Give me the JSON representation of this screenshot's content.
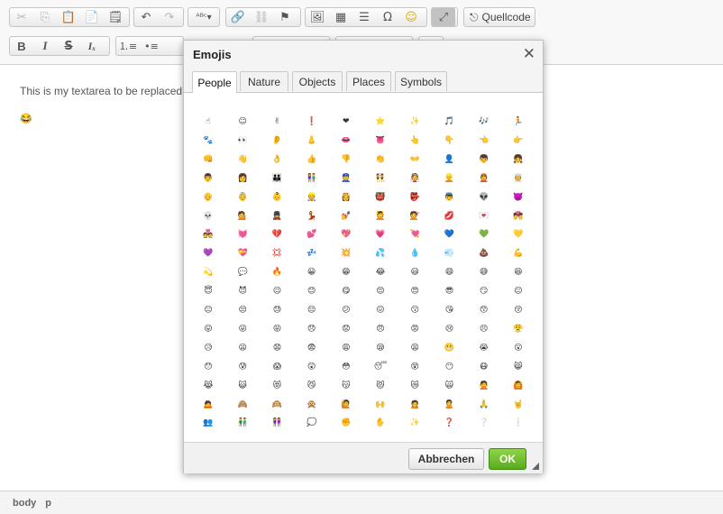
{
  "toolbar": {
    "source_label": "Quellcode"
  },
  "editor": {
    "text": "This is my textarea to be replaced",
    "emoji": "😂"
  },
  "statusbar": {
    "path": [
      "body",
      "p"
    ]
  },
  "dialog": {
    "title": "Emojis",
    "close_glyph": "✕",
    "tabs": [
      "People",
      "Nature",
      "Objects",
      "Places",
      "Symbols"
    ],
    "active_tab": "People",
    "cancel_label": "Abbrechen",
    "ok_label": "OK",
    "emoji_rows": [
      [
        "☝",
        "☺",
        "✌",
        "❗",
        "❤",
        "⭐",
        "✨",
        "🎵",
        "🎶",
        "🏃"
      ],
      [
        "🐾",
        "👀",
        "👂",
        "👃",
        "👄",
        "👅",
        "👆",
        "👇",
        "👈",
        "👉"
      ],
      [
        "👊",
        "👋",
        "👌",
        "👍",
        "👎",
        "👏",
        "👐",
        "👤",
        "👦",
        "👧"
      ],
      [
        "👨",
        "👩",
        "👪",
        "👫",
        "👮",
        "👯",
        "👰",
        "👱",
        "👲",
        "👳"
      ],
      [
        "👴",
        "👵",
        "👶",
        "👷",
        "👸",
        "👹",
        "👺",
        "👼",
        "👽",
        "👿"
      ],
      [
        "💀",
        "💁",
        "💂",
        "💃",
        "💅",
        "💆",
        "💇",
        "💋",
        "💌",
        "💏"
      ],
      [
        "💑",
        "💓",
        "💔",
        "💕",
        "💖",
        "💗",
        "💘",
        "💙",
        "💚",
        "💛"
      ],
      [
        "💜",
        "💝",
        "💢",
        "💤",
        "💥",
        "💦",
        "💧",
        "💨",
        "💩",
        "💪"
      ],
      [
        "💫",
        "💬",
        "🔥",
        "😀",
        "😁",
        "😂",
        "😃",
        "😄",
        "😅",
        "😆"
      ],
      [
        "😇",
        "😈",
        "😉",
        "😊",
        "😋",
        "😌",
        "😍",
        "😎",
        "😏",
        "😐"
      ],
      [
        "😑",
        "😒",
        "😓",
        "😔",
        "😕",
        "😖",
        "😗",
        "😘",
        "😙",
        "😚"
      ],
      [
        "😛",
        "😜",
        "😝",
        "😞",
        "😟",
        "😠",
        "😡",
        "😢",
        "😣",
        "😤"
      ],
      [
        "😥",
        "😦",
        "😧",
        "😨",
        "😩",
        "😪",
        "😫",
        "😬",
        "😭",
        "😮"
      ],
      [
        "😯",
        "😰",
        "😱",
        "😲",
        "😳",
        "😴",
        "😵",
        "😶",
        "😷",
        "😸"
      ],
      [
        "😹",
        "😺",
        "😻",
        "😼",
        "😽",
        "😾",
        "😿",
        "🙀",
        "🙅",
        "🙆"
      ],
      [
        "🙇",
        "🙈",
        "🙉",
        "🙊",
        "🙋",
        "🙌",
        "🙍",
        "🙎",
        "🙏",
        "🤘"
      ],
      [
        "👥",
        "👬",
        "👭",
        "💭",
        "✊",
        "✋",
        "✨",
        "❓",
        "❔",
        "❕"
      ]
    ]
  },
  "colors": {
    "ok_green": "#5aab1c",
    "toolbar_bg": "#f8f8f8",
    "dialog_header_bg": "#f4f4f4",
    "heart_red": "#e0245e",
    "face_yellow": "#f4b400"
  }
}
